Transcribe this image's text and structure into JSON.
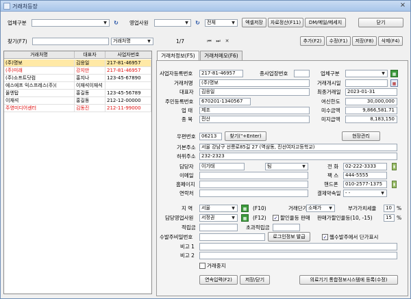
{
  "window": {
    "title": "거래처등장",
    "close": "×"
  },
  "toolbar": {
    "biz_type_label": "업체구분",
    "biz_type_value": "",
    "sales_staff_label": "영업사원",
    "sales_staff_value": "",
    "scope_value": "전체",
    "excel_save": "엑셀저장",
    "settlement": "자료정산(F11)",
    "dm_mail": "DM/메일/메세지",
    "close": "닫기"
  },
  "search": {
    "find_label": "찾기(F7)",
    "find_value": "",
    "field_value": "거래처명",
    "page_info": "1/7",
    "add": "추가(F2)",
    "edit": "수정(F1)",
    "save": "저장(F8)",
    "delete": "삭제(F4)"
  },
  "grid": {
    "headers": [
      "거래처명",
      "대표자",
      "사업자번호"
    ],
    "rows": [
      {
        "name": "(주)명보",
        "rep": "김응일",
        "bizno": "217-81-46957",
        "selected": true,
        "red": false
      },
      {
        "name": "(주)미래",
        "rep": "강지만",
        "bizno": "217-81-46957",
        "selected": false,
        "red": true
      },
      {
        "name": "(주)소프트닷컴",
        "rep": "홍지나",
        "bizno": "123-45-67890",
        "selected": false,
        "red": false
      },
      {
        "name": "에스에프 익스프레스(주)(",
        "rep": "이재석이재석",
        "bizno": "",
        "selected": false,
        "red": false
      },
      {
        "name": "올엔탑",
        "rep": "홍길동",
        "bizno": "123-45-56789",
        "selected": false,
        "red": false
      },
      {
        "name": "이재석",
        "rep": "홍길동",
        "bizno": "212-12-00000",
        "selected": false,
        "red": false
      },
      {
        "name": "주영미디어센터",
        "rep": "김동진",
        "bizno": "212-11-99000",
        "selected": false,
        "red": true
      }
    ]
  },
  "tabs": [
    "거래처정보(F5)",
    "거래처메모(F6)"
  ],
  "form": {
    "bizno_label": "사업자등록번호",
    "bizno": "217-81-46957",
    "sub_bizno_label": "종사업장번호",
    "sub_bizno": "",
    "biztype_label": "업체구분",
    "biztype": "",
    "company_label": "거래처명",
    "company": "(주)명보",
    "start_label": "거래개시일",
    "start": "",
    "rep_label": "대표자",
    "rep": "김응일",
    "last_label": "최종거래일",
    "last": "2023-01-31",
    "resno_label": "주민등록번호",
    "resno": "670201-1340567",
    "credit_label": "여신한도",
    "credit": "30,000,000",
    "uptae_label": "업  태",
    "uptae": "제조",
    "receivable_label": "미수금액",
    "receivable": "9,866,581.71",
    "jongmok_label": "종  목",
    "jongmok": "전산",
    "payable_label": "미지급액",
    "payable": "8,183,150",
    "zip_label": "우편번호",
    "zip": "06213",
    "find_addr": "찾기(\"+Enter)",
    "site_mgmt": "현장관리",
    "addr1_label": "기본주소",
    "addr1": "서울 강남구 선릉로85길 27 (역삼동, 진선여자고등학교)",
    "addr2_label": "하위주소",
    "addr2": "232-2323",
    "manager_label": "담당자",
    "manager": "이기태",
    "manager_title": "팀",
    "phone_label": "전  화",
    "phone": "02-222-3333",
    "email_label": "이메일",
    "email": "",
    "fax_label": "팩  스",
    "fax": "444-5555",
    "homepage_label": "홈페이지",
    "homepage": "",
    "mobile_label": "핸드폰",
    "mobile": "010-2577-1375",
    "contact_label": "연락처",
    "contact": "",
    "pay_label": "결제약속일",
    "pay": "-  -",
    "region_label": "지  역",
    "region": "서울",
    "region_key": "(F10)",
    "price_label": "거래단가",
    "price": "소매가",
    "vat_label": "부가가치세율",
    "vat": "10",
    "vat_unit": "%",
    "staff_label": "담당영업사원",
    "staff": "서정권",
    "staff_key": "(F12)",
    "discount_label": "할인율등 판매",
    "discount_rate_label": "판매가할인율등(10, -15)",
    "discount_rate": "15",
    "discount_unit": "%",
    "points_label": "적립금",
    "points": "",
    "excess_points_label": "초과적립금",
    "excess_points": "",
    "pw_label": "수발주비밀번호",
    "pw": "",
    "login_issue": "로그인정보 발급",
    "web_order_label": "웹수발주에서 단가표시",
    "note1_label": "비고 1",
    "note1": "",
    "note2_label": "비고 2",
    "note2": "",
    "stop_label": "거래중지",
    "continuous": "연속입력(F2)",
    "save_close": "저장/닫기",
    "register": "의료기기 통합정보시스템에 등록(수정)"
  }
}
